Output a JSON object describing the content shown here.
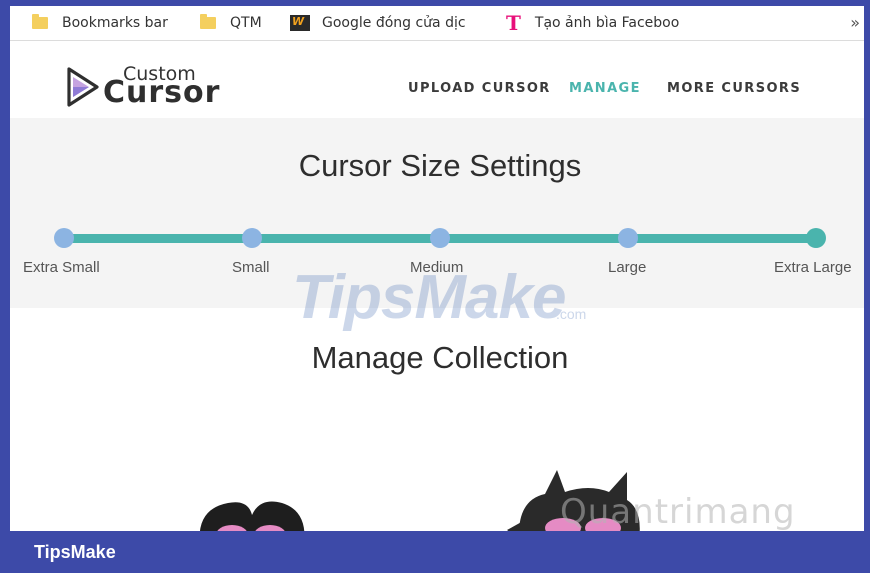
{
  "bookmarks": {
    "items": [
      {
        "label": "Bookmarks bar",
        "icon": "folder-icon"
      },
      {
        "label": "QTM",
        "icon": "folder-icon"
      },
      {
        "label": "Google đóng cửa dịc",
        "icon": "w-app-icon"
      },
      {
        "label": "Tạo ảnh bìa Faceboo",
        "icon": "t-brand-icon"
      }
    ],
    "more": "»"
  },
  "header": {
    "logo_small": "Custom",
    "logo_big": "Cursor",
    "nav": {
      "upload": "UPLOAD CURSOR",
      "manage": "MANAGE",
      "more": "MORE CURSORS"
    }
  },
  "settings": {
    "title": "Cursor Size Settings",
    "sizes": [
      "Extra Small",
      "Small",
      "Medium",
      "Large",
      "Extra Large"
    ],
    "selected": "Extra Large",
    "track_color": "#4ab4ad",
    "knob_color": "#8cb4e2"
  },
  "manage": {
    "title": "Manage Collection"
  },
  "watermarks": {
    "tipsmake": "TipsMake",
    "tipsmake_com": ".com",
    "quantrimang": "Quantrimang"
  },
  "footer": {
    "brand": "TipsMake"
  },
  "colors": {
    "frame": "#3d4aa8",
    "accent": "#4ab4ad"
  }
}
